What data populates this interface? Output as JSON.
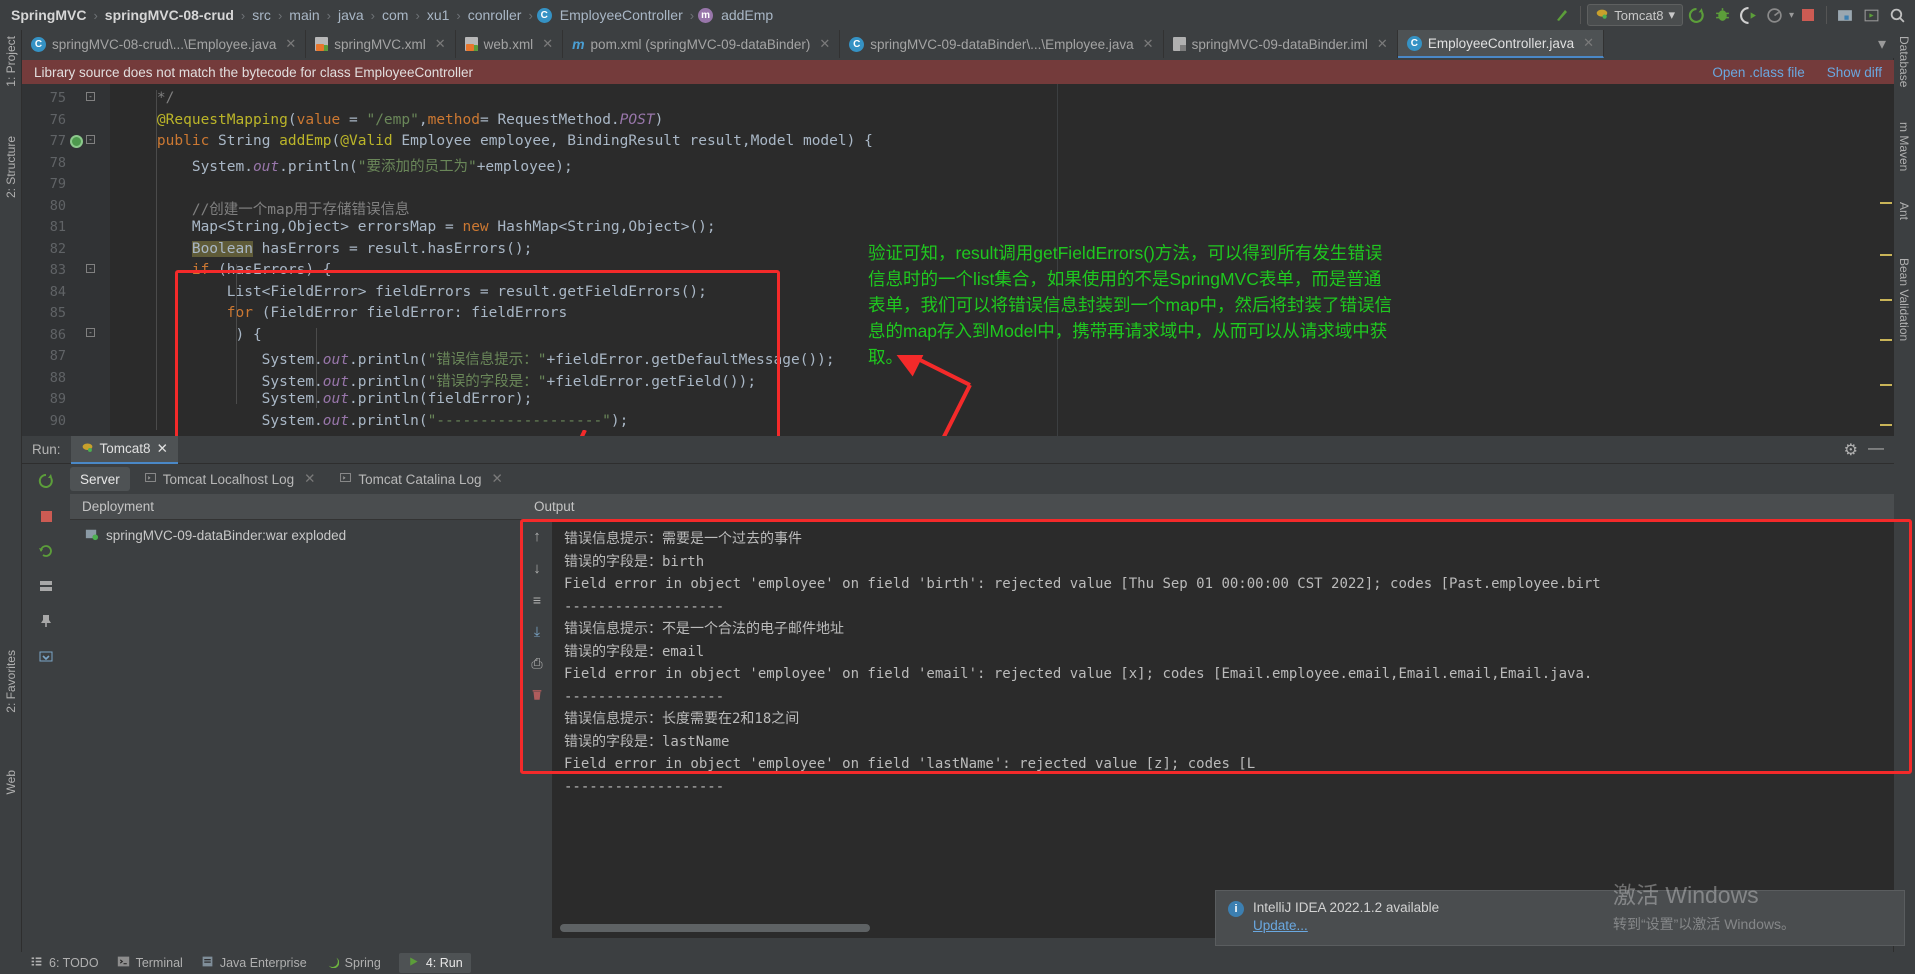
{
  "breadcrumb": {
    "items": [
      {
        "label": "SpringMVC",
        "bold": true,
        "icon": null
      },
      {
        "label": "springMVC-08-crud",
        "bold": true,
        "icon": null
      },
      {
        "label": "src",
        "bold": false,
        "icon": null
      },
      {
        "label": "main",
        "bold": false,
        "icon": null
      },
      {
        "label": "java",
        "bold": false,
        "icon": null
      },
      {
        "label": "com",
        "bold": false,
        "icon": null
      },
      {
        "label": "xu1",
        "bold": false,
        "icon": null
      },
      {
        "label": "conroller",
        "bold": false,
        "icon": null
      },
      {
        "label": "EmployeeController",
        "bold": false,
        "icon": "class-icon"
      },
      {
        "label": "addEmp",
        "bold": false,
        "icon": "method-icon"
      }
    ],
    "separator": "›"
  },
  "toolbar": {
    "hammer_icon": "build-icon",
    "run_config": {
      "label": "Tomcat8",
      "icon": "tomcat-icon",
      "chevron": "▾"
    },
    "buttons": [
      {
        "name": "run-button",
        "glyph": "⟳",
        "color": "#5c9e3a"
      },
      {
        "name": "debug-button",
        "glyph": "☣",
        "color": "#5c9e3a"
      },
      {
        "name": "run-with-coverage-button",
        "glyph": "▶",
        "color": "#5c9e3a"
      },
      {
        "name": "profiler-button",
        "glyph": "◔",
        "color": "#8a8a8a"
      },
      {
        "name": "stop-button",
        "glyph": "■",
        "color": "#cc5b53"
      },
      {
        "name": "project-structure-button",
        "glyph": "▣",
        "color": "#7aa5c7"
      },
      {
        "name": "update-app-button",
        "glyph": "▷",
        "color": "#9aa98f"
      },
      {
        "name": "search-everywhere-button",
        "glyph": "⌕",
        "color": "#b0b0b0"
      }
    ]
  },
  "tabs": [
    {
      "label": "springMVC-08-crud\\...\\Employee.java",
      "icon": "class-icon",
      "icon_text": "C",
      "active": false,
      "close": "✕"
    },
    {
      "label": "springMVC.xml",
      "icon": "xml-icon",
      "active": false,
      "close": "✕"
    },
    {
      "label": "web.xml",
      "icon": "xml-icon",
      "active": false,
      "close": "✕"
    },
    {
      "label": "pom.xml (springMVC-09-dataBinder)",
      "icon": "maven-icon",
      "icon_text": "m",
      "active": false,
      "close": "✕"
    },
    {
      "label": "springMVC-09-dataBinder\\...\\Employee.java",
      "icon": "class-icon",
      "icon_text": "C",
      "active": false,
      "close": "✕"
    },
    {
      "label": "springMVC-09-dataBinder.iml",
      "icon": "iml-icon",
      "active": false,
      "close": "✕"
    },
    {
      "label": "EmployeeController.java",
      "icon": "class-icon",
      "icon_text": "C",
      "active": true,
      "close": "✕"
    }
  ],
  "tabs_overflow_glyph": "▾",
  "banner": {
    "message": "Library source does not match the bytecode for class EmployeeController",
    "links": [
      {
        "label": "Open .class file"
      },
      {
        "label": "Show diff"
      }
    ],
    "bg_color": "#743b3b",
    "link_color": "#6aa8e0"
  },
  "editor": {
    "first_line": 75,
    "lines": [
      {
        "n": 75,
        "indent": 0,
        "segs": [
          {
            "t": "    */",
            "c": "cmt"
          }
        ]
      },
      {
        "n": 76,
        "indent": 0,
        "segs": [
          {
            "t": "    ",
            "c": ""
          },
          {
            "t": "@RequestMapping",
            "c": "ann"
          },
          {
            "t": "(",
            "c": ""
          },
          {
            "t": "value",
            "c": "kw"
          },
          {
            "t": " = ",
            "c": ""
          },
          {
            "t": "\"/emp\"",
            "c": "str"
          },
          {
            "t": ",",
            "c": ""
          },
          {
            "t": "method",
            "c": "kw"
          },
          {
            "t": "= RequestMethod.",
            "c": ""
          },
          {
            "t": "POST",
            "c": "cnst"
          },
          {
            "t": ")",
            "c": ""
          }
        ]
      },
      {
        "n": 77,
        "indent": 0,
        "segs": [
          {
            "t": "    ",
            "c": ""
          },
          {
            "t": "public",
            "c": "kw"
          },
          {
            "t": " String ",
            "c": ""
          },
          {
            "t": "addEmp",
            "c": "ann"
          },
          {
            "t": "(",
            "c": ""
          },
          {
            "t": "@Valid",
            "c": "ann"
          },
          {
            "t": " Employee employee, BindingResult result,Model model) {",
            "c": ""
          }
        ]
      },
      {
        "n": 78,
        "indent": 0,
        "segs": [
          {
            "t": "        System.",
            "c": ""
          },
          {
            "t": "out",
            "c": "fld"
          },
          {
            "t": ".println(",
            "c": ""
          },
          {
            "t": "\"要添加的员工为\"",
            "c": "str"
          },
          {
            "t": "+employee);",
            "c": ""
          }
        ]
      },
      {
        "n": 79,
        "indent": 0,
        "segs": [
          {
            "t": "",
            "c": ""
          }
        ]
      },
      {
        "n": 80,
        "indent": 0,
        "segs": [
          {
            "t": "        ",
            "c": ""
          },
          {
            "t": "//创建一个map用于存储错误信息",
            "c": "cmt"
          }
        ]
      },
      {
        "n": 81,
        "indent": 0,
        "segs": [
          {
            "t": "        Map<String,Object> errorsMap = ",
            "c": ""
          },
          {
            "t": "new",
            "c": "kw"
          },
          {
            "t": " HashMap<String,Object>();",
            "c": ""
          }
        ]
      },
      {
        "n": 82,
        "indent": 0,
        "segs": [
          {
            "t": "        ",
            "c": ""
          },
          {
            "t": "Boolean",
            "c": "hl"
          },
          {
            "t": " hasErrors = result.hasErrors();",
            "c": ""
          }
        ]
      },
      {
        "n": 83,
        "indent": 0,
        "segs": [
          {
            "t": "        ",
            "c": ""
          },
          {
            "t": "if",
            "c": "kw"
          },
          {
            "t": " (hasErrors) {",
            "c": ""
          }
        ]
      },
      {
        "n": 84,
        "indent": 0,
        "segs": [
          {
            "t": "            List<FieldError> fieldErrors = result.getFieldErrors();",
            "c": ""
          }
        ]
      },
      {
        "n": 85,
        "indent": 0,
        "segs": [
          {
            "t": "            ",
            "c": ""
          },
          {
            "t": "for",
            "c": "kw"
          },
          {
            "t": " (FieldError fieldError: fieldErrors",
            "c": ""
          }
        ]
      },
      {
        "n": 86,
        "indent": 0,
        "segs": [
          {
            "t": "             ) {",
            "c": ""
          }
        ]
      },
      {
        "n": 87,
        "indent": 0,
        "segs": [
          {
            "t": "                System.",
            "c": ""
          },
          {
            "t": "out",
            "c": "fld"
          },
          {
            "t": ".println(",
            "c": ""
          },
          {
            "t": "\"错误信息提示：\"",
            "c": "str"
          },
          {
            "t": "+fieldError.getDefaultMessage());",
            "c": ""
          }
        ]
      },
      {
        "n": 88,
        "indent": 0,
        "segs": [
          {
            "t": "                System.",
            "c": ""
          },
          {
            "t": "out",
            "c": "fld"
          },
          {
            "t": ".println(",
            "c": ""
          },
          {
            "t": "\"错误的字段是：\"",
            "c": "str"
          },
          {
            "t": "+fieldError.getField());",
            "c": ""
          }
        ]
      },
      {
        "n": 89,
        "indent": 0,
        "segs": [
          {
            "t": "                System.",
            "c": ""
          },
          {
            "t": "out",
            "c": "fld"
          },
          {
            "t": ".println(fieldError);",
            "c": ""
          }
        ]
      },
      {
        "n": 90,
        "indent": 0,
        "segs": [
          {
            "t": "                System.",
            "c": ""
          },
          {
            "t": "out",
            "c": "fld"
          },
          {
            "t": ".println(",
            "c": ""
          },
          {
            "t": "\"-------------------\"",
            "c": "str"
          },
          {
            "t": ");",
            "c": ""
          }
        ]
      }
    ]
  },
  "annotation": {
    "text": "验证可知，result调用getFieldErrors()方法，可以得到所有发生错误\n信息时的一个list集合，如果使用的不是SpringMVC表单，而是普通\n表单，我们可以将错误信息封装到一个map中，然后将封装了错误信\n息的map存入到Model中，携带再请求域中，从而可以从请求域中获\n取。",
    "color": "#1fc81f",
    "box_color": "#f42a2a"
  },
  "run_window": {
    "title": "Run:",
    "tab": {
      "label": "Tomcat8",
      "icon": "tomcat-icon",
      "close": "✕"
    },
    "header_buttons": [
      {
        "name": "settings-icon",
        "glyph": "⚙"
      },
      {
        "name": "minimize-icon",
        "glyph": "—"
      }
    ],
    "subtabs": [
      {
        "label": "Server",
        "active": true
      },
      {
        "label": "Tomcat Localhost Log",
        "active": false,
        "icon": "console-icon",
        "close": "✕"
      },
      {
        "label": "Tomcat Catalina Log",
        "active": false,
        "icon": "console-icon",
        "close": "✕"
      }
    ],
    "left_tools": [
      {
        "name": "rerun-button",
        "glyph": "⟳",
        "color": "#5c9e3a"
      },
      {
        "name": "stop-button",
        "glyph": "■",
        "color": "#cc5b53"
      },
      {
        "name": "restart-button",
        "glyph": "↻",
        "color": "#b0b0b0"
      },
      {
        "name": "layout-button",
        "glyph": "▦",
        "color": "#b0b0b0"
      },
      {
        "name": "pin-button",
        "glyph": "✔",
        "color": "#b0b0b0"
      },
      {
        "name": "redeploy-button",
        "glyph": "↻",
        "color": "#b0b0b0"
      },
      {
        "name": "deploy-button",
        "glyph": "❐",
        "color": "#b0b0b0"
      }
    ],
    "deployment": {
      "header": "Deployment",
      "items": [
        {
          "label": "springMVC-09-dataBinder:war exploded",
          "icon": "artifact-icon"
        }
      ]
    },
    "output": {
      "header": "Output",
      "tools": [
        {
          "name": "scroll-up-icon",
          "glyph": "↑"
        },
        {
          "name": "scroll-down-icon",
          "glyph": "↓"
        },
        {
          "name": "soft-wrap-icon",
          "glyph": "≡"
        },
        {
          "name": "scroll-to-end-icon",
          "glyph": "⤓"
        },
        {
          "name": "print-icon",
          "glyph": "⎙"
        },
        {
          "name": "clear-all-icon",
          "glyph": "Ὕ1"
        }
      ],
      "lines": [
        "错误信息提示：需要是一个过去的事件",
        "错误的字段是：birth",
        "Field error in object 'employee' on field 'birth': rejected value [Thu Sep 01 00:00:00 CST 2022]; codes [Past.employee.birt",
        "-------------------",
        "错误信息提示：不是一个合法的电子邮件地址",
        "错误的字段是：email",
        "Field error in object 'employee' on field 'email': rejected value [x]; codes [Email.employee.email,Email.email,Email.java.",
        "-------------------",
        "错误信息提示：长度需要在2和18之间",
        "错误的字段是：lastName",
        "Field error in object 'employee' on field 'lastName': rejected value [z]; codes [L",
        "-------------------"
      ]
    }
  },
  "status_bar": {
    "items": [
      {
        "label": "6: TODO",
        "icon": "todo-icon",
        "active": false
      },
      {
        "label": "Terminal",
        "icon": "terminal-icon",
        "active": false
      },
      {
        "label": "Java Enterprise",
        "icon": "java-enterprise-icon",
        "active": false
      },
      {
        "label": "Spring",
        "icon": "spring-icon",
        "active": false
      },
      {
        "label": "4: Run",
        "icon": "run-icon",
        "active": true
      }
    ]
  },
  "left_rail": {
    "items": [
      {
        "label": "1: Project"
      },
      {
        "label": "2: Structure"
      },
      {
        "label": "2: Favorites"
      },
      {
        "label": "Web"
      }
    ]
  },
  "right_rail": {
    "items": [
      {
        "label": "Database"
      },
      {
        "label": "m Maven"
      },
      {
        "label": "Ant"
      },
      {
        "label": "Bean Validation"
      }
    ]
  },
  "notification": {
    "icon": "info-icon",
    "title": "IntelliJ IDEA 2022.1.2 available",
    "link": "Update..."
  },
  "watermark": {
    "line1": "激活 Windows",
    "line2": "转到“设置”以激活 Windows。"
  }
}
